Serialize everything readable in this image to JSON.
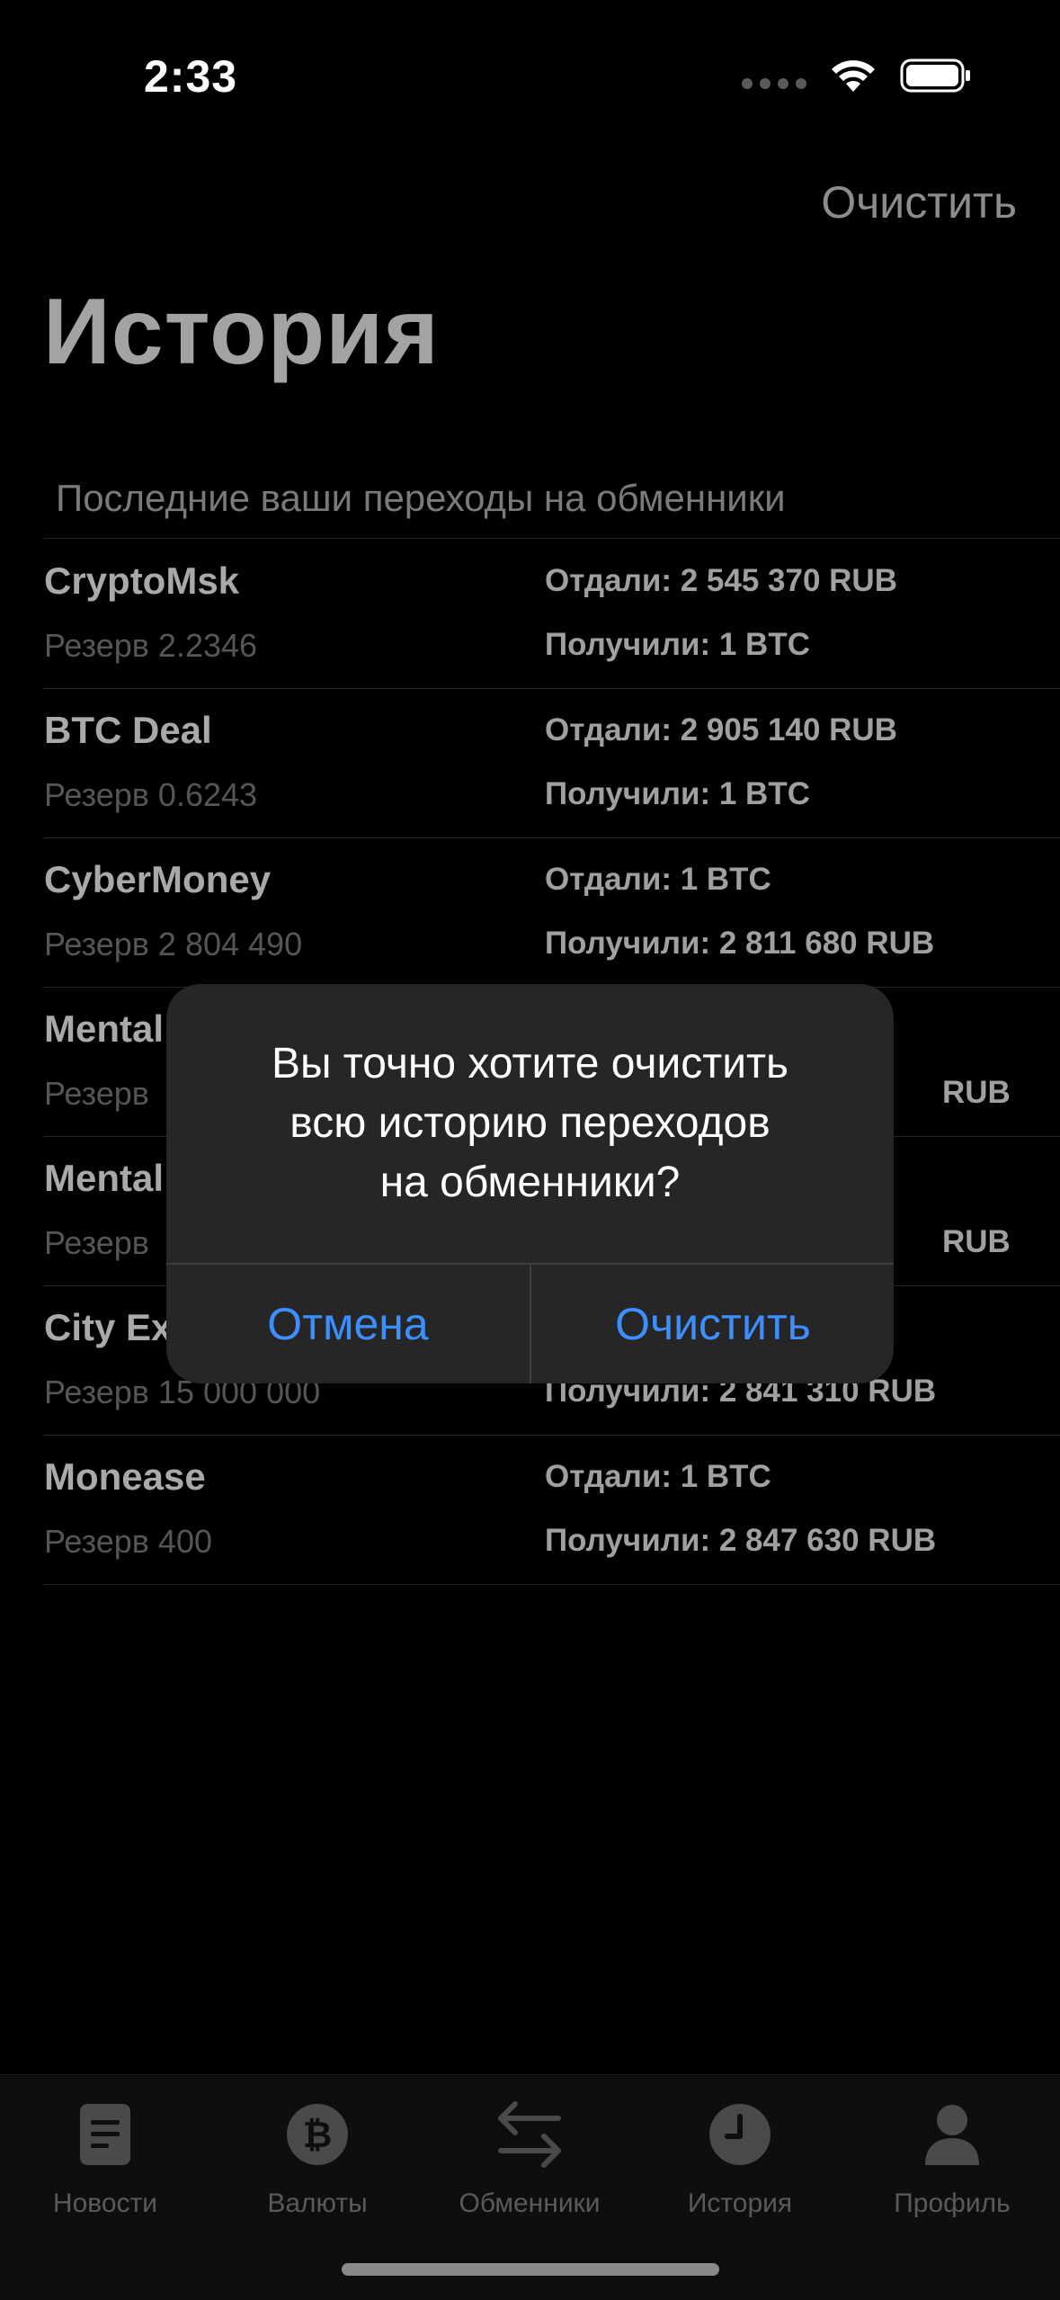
{
  "status_bar": {
    "time": "2:33"
  },
  "nav": {
    "clear_label": "Очистить",
    "title": "История"
  },
  "section_header": "Последние ваши переходы на обменники",
  "history": [
    {
      "name": "CryptoMsk",
      "reserve": "Резерв 2.2346",
      "gave": "Отдали: 2 545 370 RUB",
      "got": "Получили: 1 BTC"
    },
    {
      "name": "BTC Deal",
      "reserve": "Резерв 0.6243",
      "gave": "Отдали: 2 905 140 RUB",
      "got": "Получили: 1 BTC"
    },
    {
      "name": "CyberMoney",
      "reserve": "Резерв 2 804 490",
      "gave": "Отдали: 1 BTC",
      "got": "Получили: 2 811 680 RUB"
    },
    {
      "name": "Mental",
      "reserve": "Резерв",
      "gave": "",
      "got": "RUB"
    },
    {
      "name": "Mental",
      "reserve": "Резерв",
      "gave": "",
      "got": "RUB"
    },
    {
      "name": "City Ex",
      "reserve": "Резерв 15 000 000",
      "gave": "",
      "got": "Получили: 2 841 310 RUB"
    },
    {
      "name": "Monease",
      "reserve": "Резерв 400",
      "gave": "Отдали: 1 BTC",
      "got": "Получили: 2 847 630 RUB"
    }
  ],
  "alert": {
    "message": "Вы точно хотите очистить\nвсю историю переходов\nна обменники?",
    "cancel_label": "Отмена",
    "confirm_label": "Очистить"
  },
  "tabs": [
    {
      "label": "Новости",
      "icon": "news-icon"
    },
    {
      "label": "Валюты",
      "icon": "bitcoin-icon"
    },
    {
      "label": "Обменники",
      "icon": "exchange-arrows-icon"
    },
    {
      "label": "История",
      "icon": "clock-icon"
    },
    {
      "label": "Профиль",
      "icon": "profile-icon"
    }
  ],
  "colors": {
    "accent": "#3d8fff",
    "background": "#000000",
    "alert_bg": "#262626"
  }
}
